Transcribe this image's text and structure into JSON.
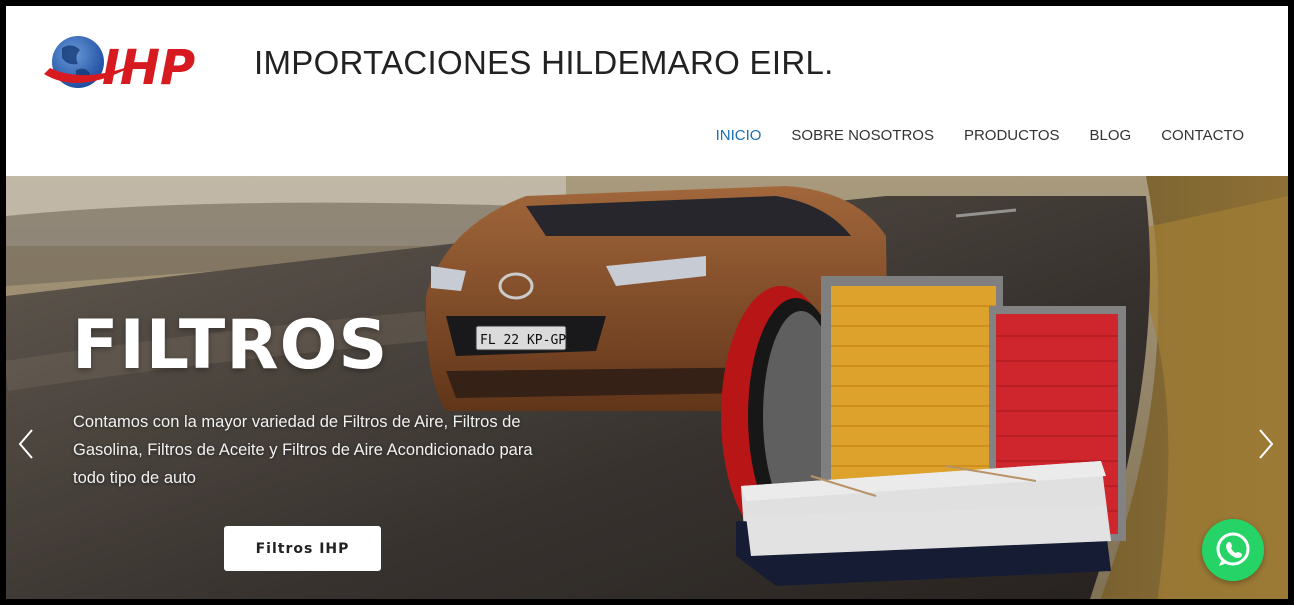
{
  "header": {
    "logo_text": "IHP",
    "company_name": "IMPORTACIONES HILDEMARO EIRL."
  },
  "nav": {
    "items": [
      {
        "label": "INICIO",
        "active": true
      },
      {
        "label": "SOBRE NOSOTROS",
        "active": false
      },
      {
        "label": "PRODUCTOS",
        "active": false
      },
      {
        "label": "BLOG",
        "active": false
      },
      {
        "label": "CONTACTO",
        "active": false
      }
    ]
  },
  "hero": {
    "title": "FILTROS",
    "description": "Contamos con la mayor variedad de Filtros de Aire, Filtros de Gasolina, Filtros de Aceite y Filtros de Aire Acondicionado para todo tipo de auto",
    "button_label": "Filtros IHP",
    "license_plate": "FL 22 KP-GP",
    "prev_icon": "chevron-left-icon",
    "next_icon": "chevron-right-icon"
  },
  "floating": {
    "whatsapp_icon": "whatsapp-icon"
  },
  "colors": {
    "nav_active": "#1a6fb5",
    "brand_red": "#d71920",
    "brand_blue": "#1f4ea1",
    "whatsapp_green": "#25d366"
  }
}
